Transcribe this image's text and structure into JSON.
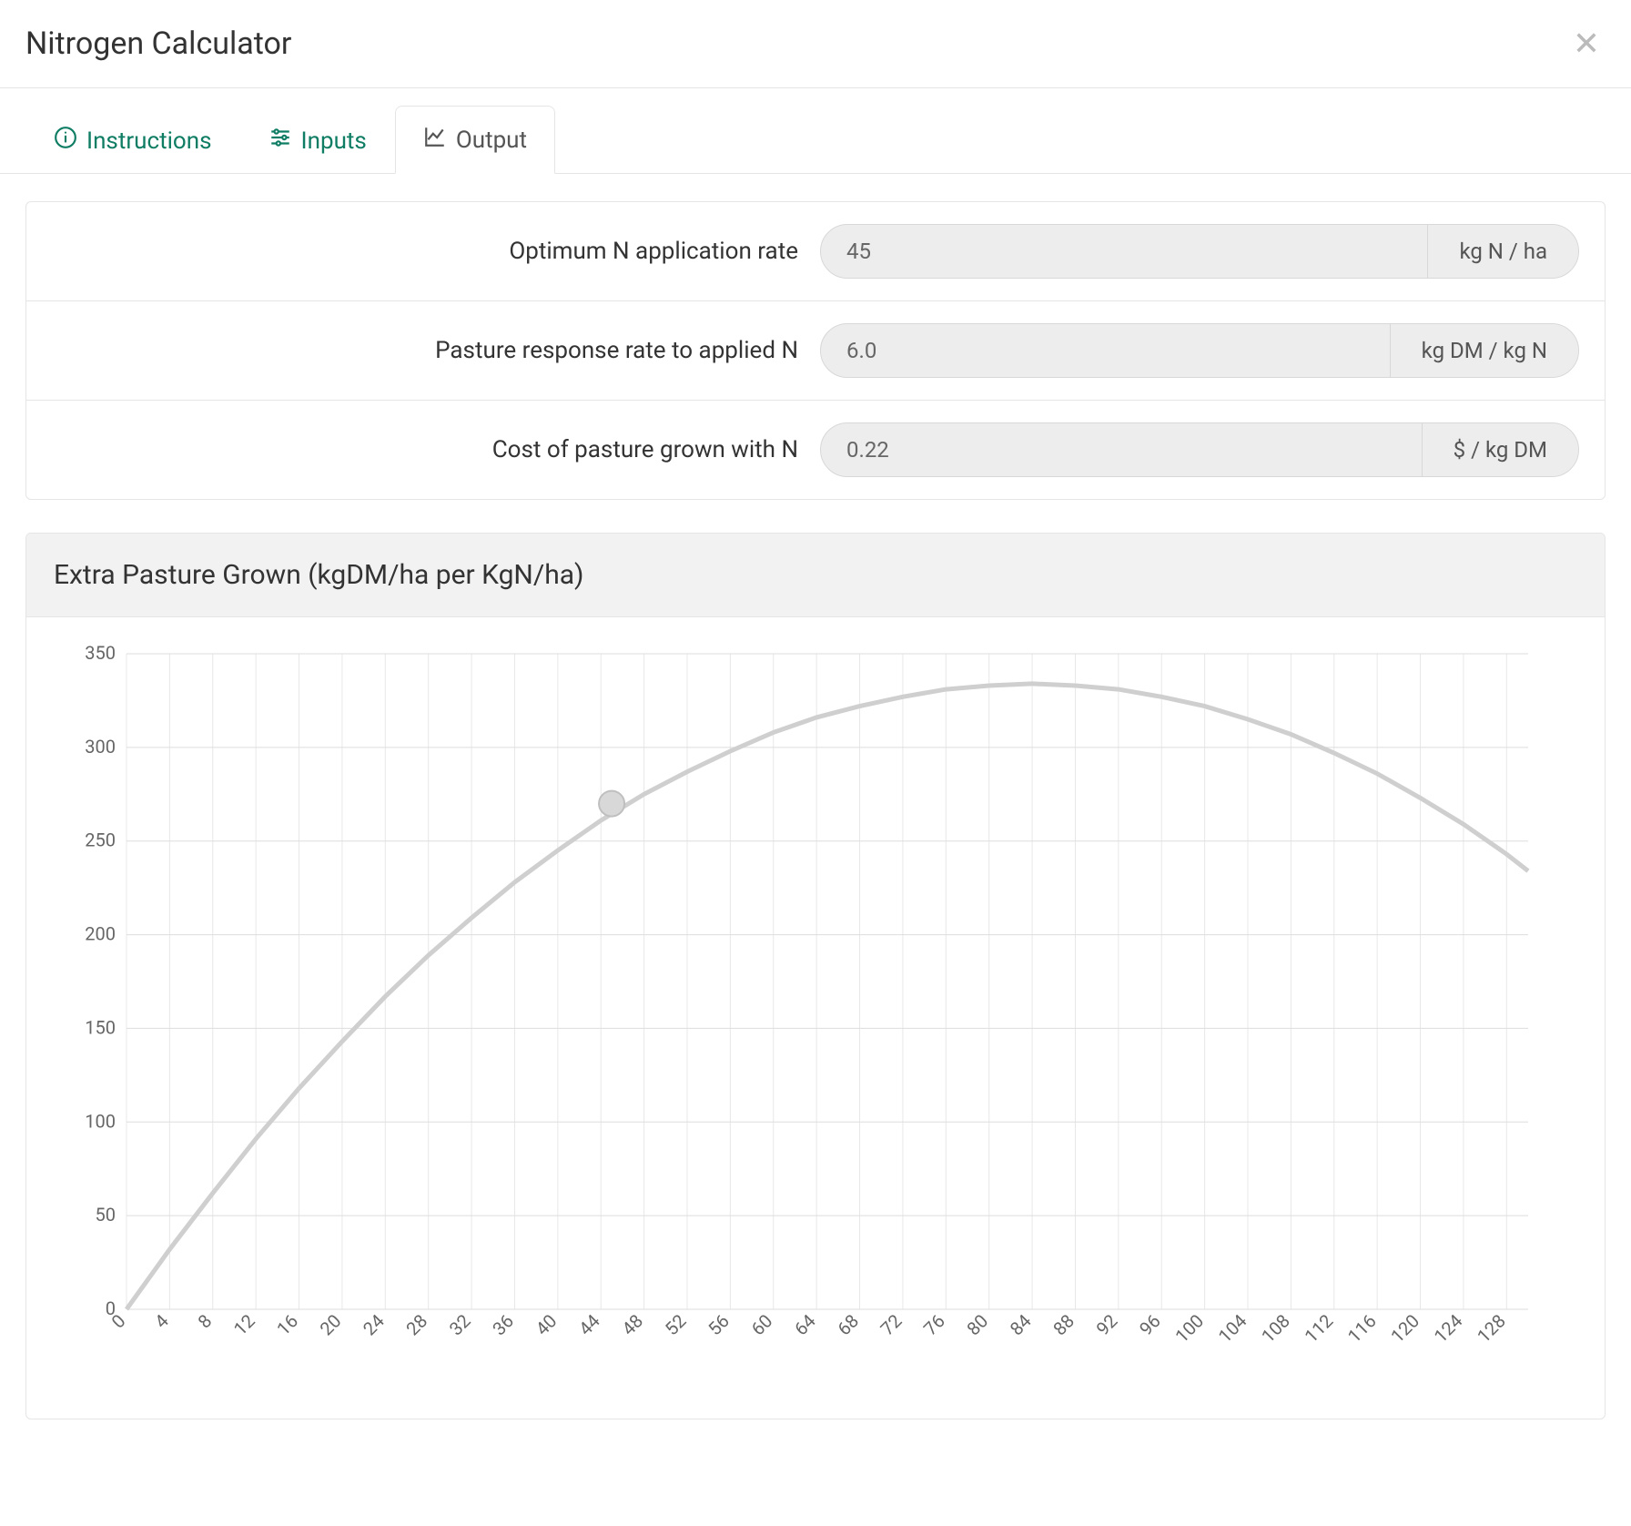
{
  "header": {
    "title": "Nitrogen Calculator"
  },
  "tabs": {
    "instructions": "Instructions",
    "inputs": "Inputs",
    "output": "Output"
  },
  "outputs": [
    {
      "label": "Optimum N application rate",
      "value": "45",
      "unit": "kg N / ha"
    },
    {
      "label": "Pasture response rate to applied N",
      "value": "6.0",
      "unit": "kg DM / kg N"
    },
    {
      "label": "Cost of pasture grown with N",
      "value": "0.22",
      "unit": "$ / kg DM"
    }
  ],
  "chart_data": {
    "type": "line",
    "title": "Extra Pasture Grown (kgDM/ha per KgN/ha)",
    "xlabel": "",
    "ylabel": "",
    "ylim": [
      0,
      350
    ],
    "xlim": [
      0,
      130
    ],
    "x_ticks": [
      0,
      4,
      8,
      12,
      16,
      20,
      24,
      28,
      32,
      36,
      40,
      44,
      48,
      52,
      56,
      60,
      64,
      68,
      72,
      76,
      80,
      84,
      88,
      92,
      96,
      100,
      104,
      108,
      112,
      116,
      120,
      124,
      128
    ],
    "y_ticks": [
      0,
      50,
      100,
      150,
      200,
      250,
      300,
      350
    ],
    "series": [
      {
        "name": "Extra pasture grown",
        "x": [
          0,
          4,
          8,
          12,
          16,
          20,
          24,
          28,
          32,
          36,
          40,
          44,
          48,
          52,
          56,
          60,
          64,
          68,
          72,
          76,
          80,
          84,
          88,
          92,
          96,
          100,
          104,
          108,
          112,
          116,
          120,
          124,
          128,
          130
        ],
        "y": [
          0,
          32,
          62,
          91,
          118,
          143,
          167,
          189,
          209,
          228,
          245,
          261,
          275,
          287,
          298,
          308,
          316,
          322,
          327,
          331,
          333,
          334,
          333,
          331,
          327,
          322,
          315,
          307,
          297,
          286,
          273,
          259,
          243,
          234
        ]
      }
    ],
    "marker": {
      "x": 45,
      "y": 270
    }
  }
}
